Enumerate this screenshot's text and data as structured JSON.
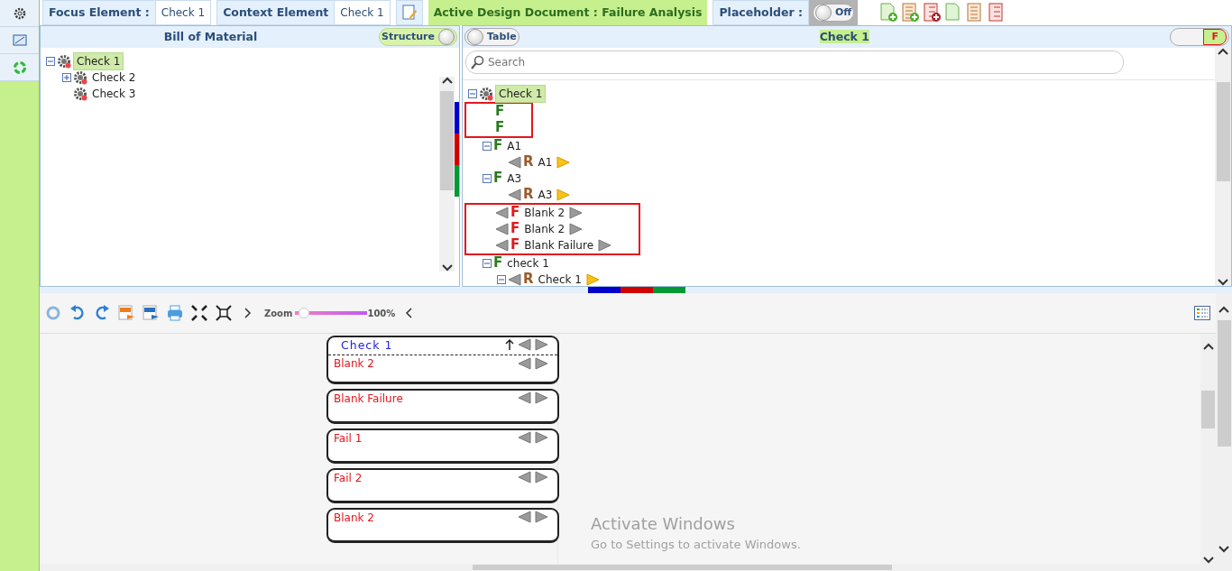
{
  "header": {
    "focus_element": {
      "label": "Focus Element :",
      "value": "Check 1"
    },
    "context_element": {
      "label": "Context Element",
      "value": "Check 1"
    },
    "active_document": "Active Design Document : Failure Analysis",
    "placeholder": {
      "label": "Placeholder :",
      "toggle": {
        "label": "Off",
        "on": false
      }
    }
  },
  "bom_panel": {
    "title": "Bill of Material",
    "toggle": {
      "label": "Structure",
      "on": true
    },
    "tree": [
      {
        "label": "Check 1",
        "selected": true,
        "expanded": true,
        "children": [
          {
            "label": "Check 2",
            "selected": false,
            "expanded": false
          },
          {
            "label": "Check 3",
            "selected": false
          }
        ]
      }
    ]
  },
  "tree_panel": {
    "toggle": {
      "label": "Table",
      "on": false
    },
    "title": "Check 1",
    "filter": {
      "label": "F",
      "on": true
    },
    "search": {
      "placeholder": "Search"
    },
    "tree": [
      {
        "kind": "check",
        "label": "Check 1",
        "selected": true,
        "expanded": true,
        "children": [
          {
            "kind": "function",
            "letter": "F",
            "flagged": true
          },
          {
            "kind": "function",
            "letter": "F",
            "flagged": true
          },
          {
            "kind": "function",
            "letter": "F",
            "label": "A1",
            "flagged": false,
            "expanded": true,
            "children": [
              {
                "kind": "requirement",
                "letter": "R",
                "label": "A1",
                "flagged": false
              }
            ]
          },
          {
            "kind": "function",
            "letter": "F",
            "label": "A3",
            "flagged": false,
            "expanded": true,
            "children": [
              {
                "kind": "requirement",
                "letter": "R",
                "label": "A3",
                "flagged": false
              }
            ]
          },
          {
            "kind": "failure",
            "letter": "F",
            "label": "Blank 2",
            "flagged": true
          },
          {
            "kind": "failure",
            "letter": "F",
            "label": "Blank 2",
            "flagged": true
          },
          {
            "kind": "failure",
            "letter": "F",
            "label": "Blank Failure",
            "flagged": true
          },
          {
            "kind": "function",
            "letter": "F",
            "label": "check 1",
            "flagged": false,
            "expanded": true,
            "children": [
              {
                "kind": "requirement",
                "letter": "R",
                "label": "Check 1",
                "flagged": false,
                "expanded": true
              }
            ]
          }
        ]
      }
    ]
  },
  "toolbar": {
    "zoom_label": "Zoom",
    "zoom": {
      "level": 0.12
    },
    "zoom_reading": "100%"
  },
  "canvas": {
    "cards": [
      {
        "title": "Check 1",
        "label": "Blank 2"
      },
      {
        "label": "Blank Failure"
      },
      {
        "label": "Fail 1"
      },
      {
        "label": "Fail 2"
      },
      {
        "label": "Blank 2"
      }
    ]
  },
  "watermark": {
    "title": "Activate Windows",
    "subtitle": "Go to Settings to activate Windows."
  }
}
